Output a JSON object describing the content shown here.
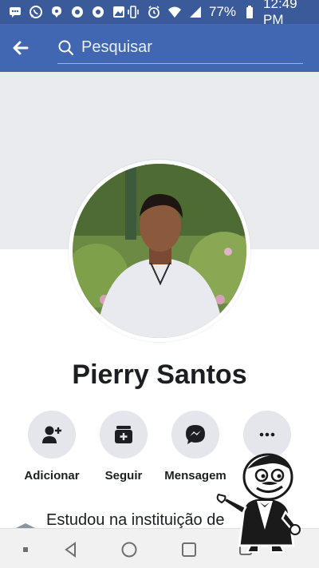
{
  "status_bar": {
    "battery": "77%",
    "time": "12:49 PM",
    "icons": [
      "message-icon",
      "whatsapp-icon",
      "notification-icon",
      "chrome-icon",
      "chrome-icon",
      "gallery-icon",
      "vibrate-icon",
      "alarm-icon",
      "wifi-icon",
      "signal-icon",
      "battery-icon"
    ]
  },
  "header": {
    "search_placeholder": "Pesquisar",
    "back_icon": "arrow-left-icon",
    "search_icon": "search-icon"
  },
  "profile": {
    "name": "Pierry Santos"
  },
  "actions": [
    {
      "label": "Adicionar",
      "icon": "add-friend-icon"
    },
    {
      "label": "Seguir",
      "icon": "follow-icon"
    },
    {
      "label": "Mensagem",
      "icon": "messenger-icon"
    },
    {
      "label": "",
      "icon": "more-icon"
    }
  ],
  "info": {
    "text": "Estudou na instituição de"
  },
  "nav": [
    "square-dot-icon",
    "back-triangle-icon",
    "home-circle-icon",
    "recents-square-icon",
    "sim-icon"
  ],
  "colors": {
    "status_bar": "#3a5a99",
    "header": "#4267b2",
    "cover": "#e9ebee",
    "action_circle": "#e4e6eb"
  }
}
